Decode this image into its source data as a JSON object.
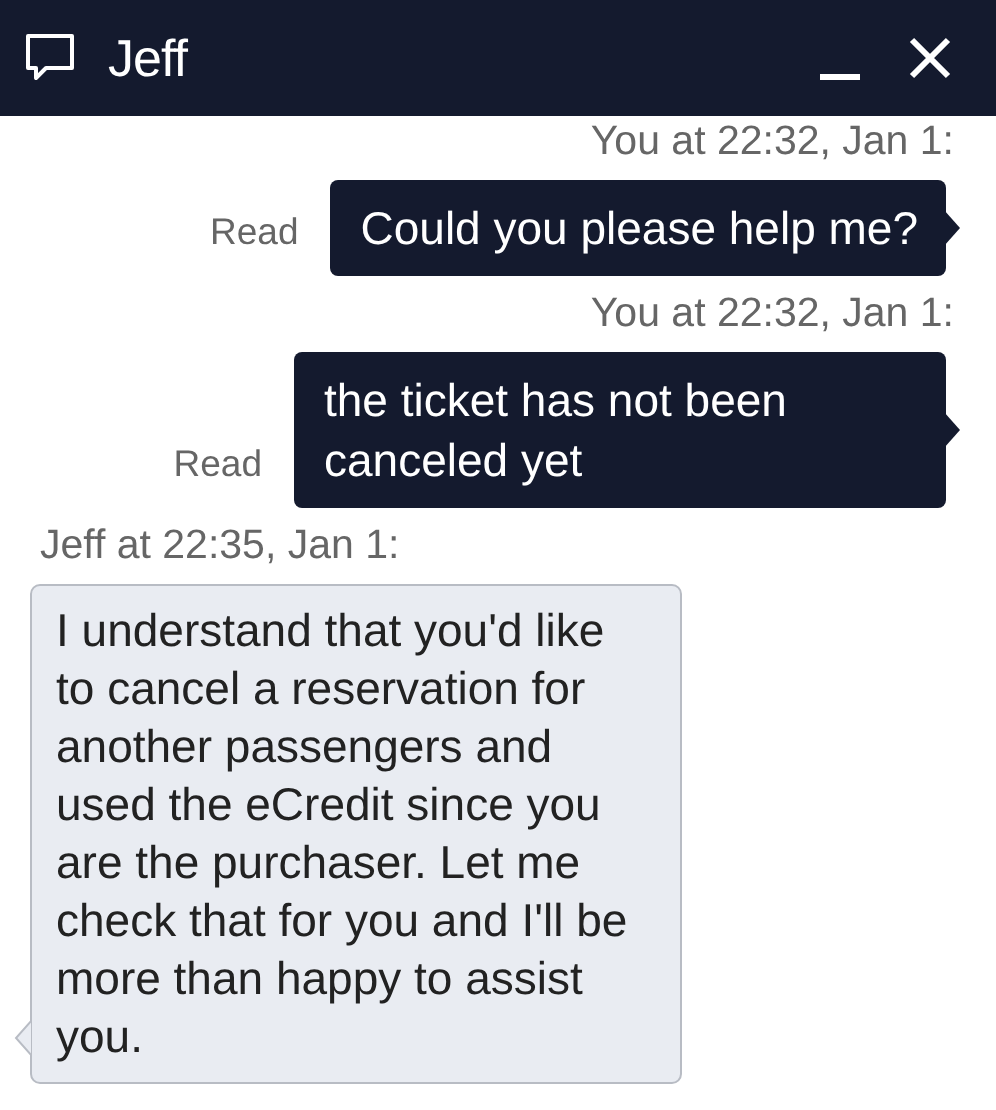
{
  "header": {
    "title": "Jeff"
  },
  "messages": [
    {
      "kind": "outgoing",
      "meta": "You at 22:32, Jan 1:",
      "text": "Could you please help me?",
      "receipt": "Read"
    },
    {
      "kind": "outgoing",
      "meta": "You at 22:32, Jan 1:",
      "text": "the ticket has not been canceled yet",
      "receipt": "Read"
    },
    {
      "kind": "incoming",
      "meta": "Jeff at 22:35, Jan 1:",
      "text": "I understand that you'd like to cancel a reservation for another passengers and used the eCredit since you are the purchaser. Let me check that for you and I'll be more than happy to assist you."
    }
  ]
}
